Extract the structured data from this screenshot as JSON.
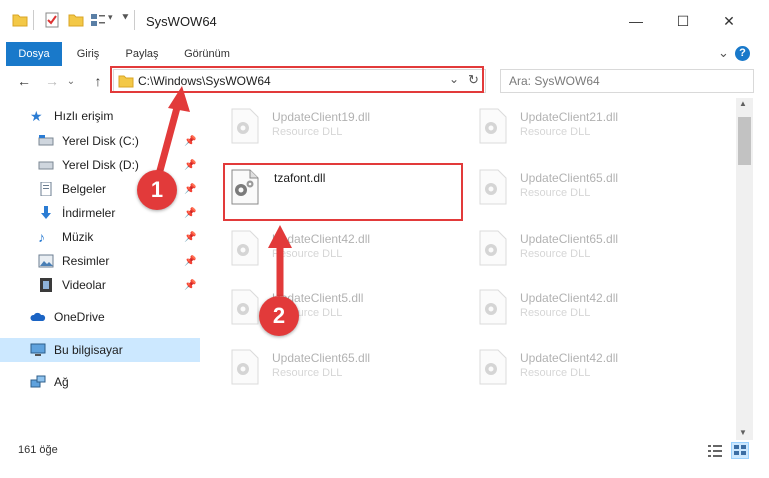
{
  "window": {
    "title": "SysWOW64",
    "minimize": "—",
    "maximize": "☐",
    "close": "✕"
  },
  "ribbon": {
    "tabs": [
      "Dosya",
      "Giriş",
      "Paylaş",
      "Görünüm"
    ],
    "expand": "⌄",
    "help": "?"
  },
  "nav": {
    "back": "←",
    "forward": "→",
    "recent": "⌄",
    "up": "↑",
    "address": "C:\\Windows\\SysWOW64",
    "address_dropdown": "⌄",
    "refresh": "↻",
    "search_placeholder": "Ara: SysWOW64",
    "search_icon": "⚲"
  },
  "sidebar": {
    "quick_access": "Hızlı erişim",
    "items": [
      {
        "label": "Yerel Disk (C:)",
        "icon": "drive-icon",
        "pinned": true
      },
      {
        "label": "Yerel Disk (D:)",
        "icon": "drive-icon",
        "pinned": true
      },
      {
        "label": "Belgeler",
        "icon": "documents-icon",
        "pinned": true
      },
      {
        "label": "İndirmeler",
        "icon": "downloads-icon",
        "pinned": true
      },
      {
        "label": "Müzik",
        "icon": "music-icon",
        "pinned": true
      },
      {
        "label": "Resimler",
        "icon": "pictures-icon",
        "pinned": true
      },
      {
        "label": "Videolar",
        "icon": "videos-icon",
        "pinned": true
      }
    ],
    "onedrive": "OneDrive",
    "this_pc": "Bu bilgisayar",
    "network": "Ağ"
  },
  "files": {
    "highlighted": {
      "name": "tzafont.dll",
      "desc": ""
    },
    "col1": [
      {
        "name": "UpdateClient19.dll",
        "desc": "Resource DLL"
      },
      {
        "name": "UpdateClient42.dll",
        "desc": "Resource DLL"
      },
      {
        "name": "UpdateClient5.dll",
        "desc": "Resource DLL"
      },
      {
        "name": "UpdateClient65.dll",
        "desc": "Resource DLL"
      }
    ],
    "col2": [
      {
        "name": "UpdateClient21.dll",
        "desc": "Resource DLL"
      },
      {
        "name": "UpdateClient65.dll",
        "desc": "Resource DLL"
      },
      {
        "name": "UpdateClient65.dll",
        "desc": "Resource DLL"
      },
      {
        "name": "UpdateClient42.dll",
        "desc": "Resource DLL"
      },
      {
        "name": "UpdateClient42.dll",
        "desc": "Resource DLL"
      }
    ]
  },
  "annotations": {
    "step1": "1",
    "step2": "2",
    "accent": "#e23a3a"
  },
  "status": {
    "count": "161 öğe"
  }
}
